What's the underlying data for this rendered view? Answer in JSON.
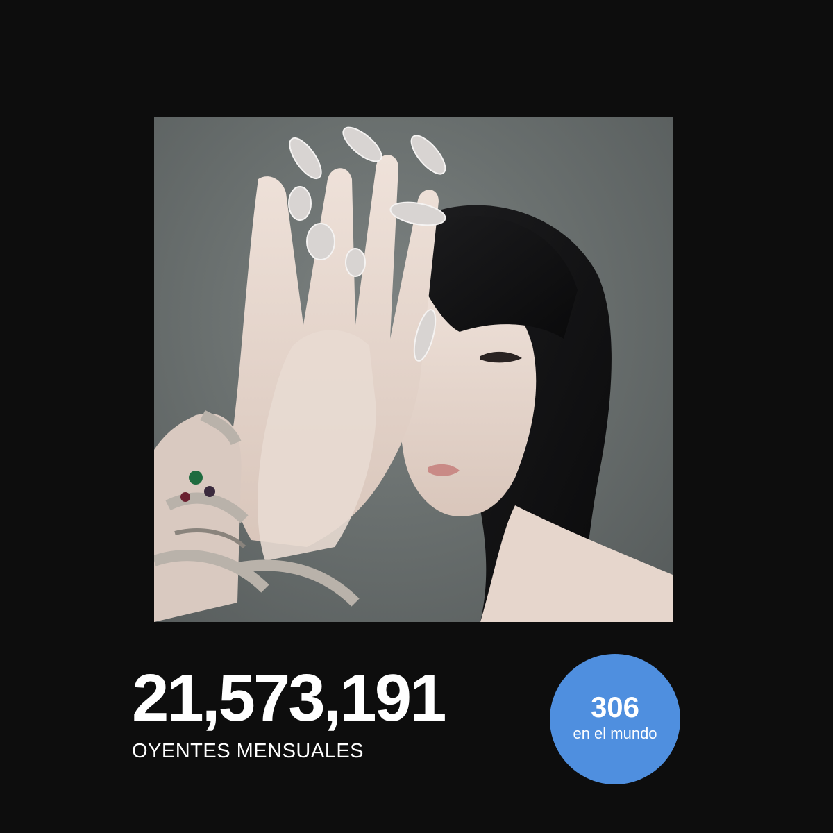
{
  "stats": {
    "monthly_listeners": "21,573,191",
    "monthly_listeners_label": "OYENTES MENSUALES"
  },
  "rank": {
    "number": "306",
    "label": "en el mundo"
  },
  "colors": {
    "background": "#0d0d0d",
    "badge": "#4f8fdf",
    "text": "#ffffff"
  },
  "photo": {
    "icon": "artist-portrait"
  }
}
